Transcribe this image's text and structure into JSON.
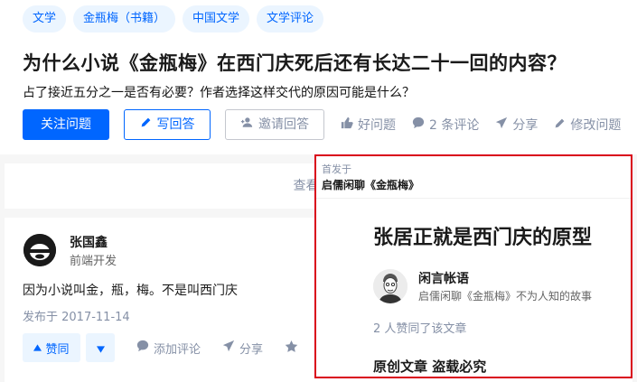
{
  "question": {
    "topics": [
      "文学",
      "金瓶梅（书籍）",
      "中国文学",
      "文学评论"
    ],
    "title": "为什么小说《金瓶梅》在西门庆死后还有长达二十一回的内容？",
    "detail": "占了接近五分之一是否有必要？作者选择这样交代的原因可能是什么？",
    "actions": {
      "follow": "关注问题",
      "write": "写回答",
      "invite": "邀请回答",
      "good": "好问题",
      "comments": "2 条评论",
      "share": "分享",
      "edit": "修改问题"
    },
    "view_all": "查看全部"
  },
  "answer": {
    "author": "张国鑫",
    "headline": "前端开发",
    "content": "因为小说叫金，瓶，梅。不是叫西门庆",
    "date": "发布于 2017-11-14",
    "actions": {
      "upvote": "赞同",
      "comment": "添加评论",
      "share": "分享"
    }
  },
  "popup": {
    "from_label": "首发于",
    "column": "启儒闲聊《金瓶梅》",
    "title": "张居正就是西门庆的原型",
    "author": "闲言帐语",
    "author_desc": "启儒闲聊《金瓶梅》不为人知的故事",
    "likes": "2 人赞同了该文章",
    "original": "原创文章 盗载必究"
  },
  "colors": {
    "accent": "#0066ff",
    "tag_bg": "#ebf5ff",
    "muted": "#8590a6",
    "highlight_border": "#d9001b"
  }
}
